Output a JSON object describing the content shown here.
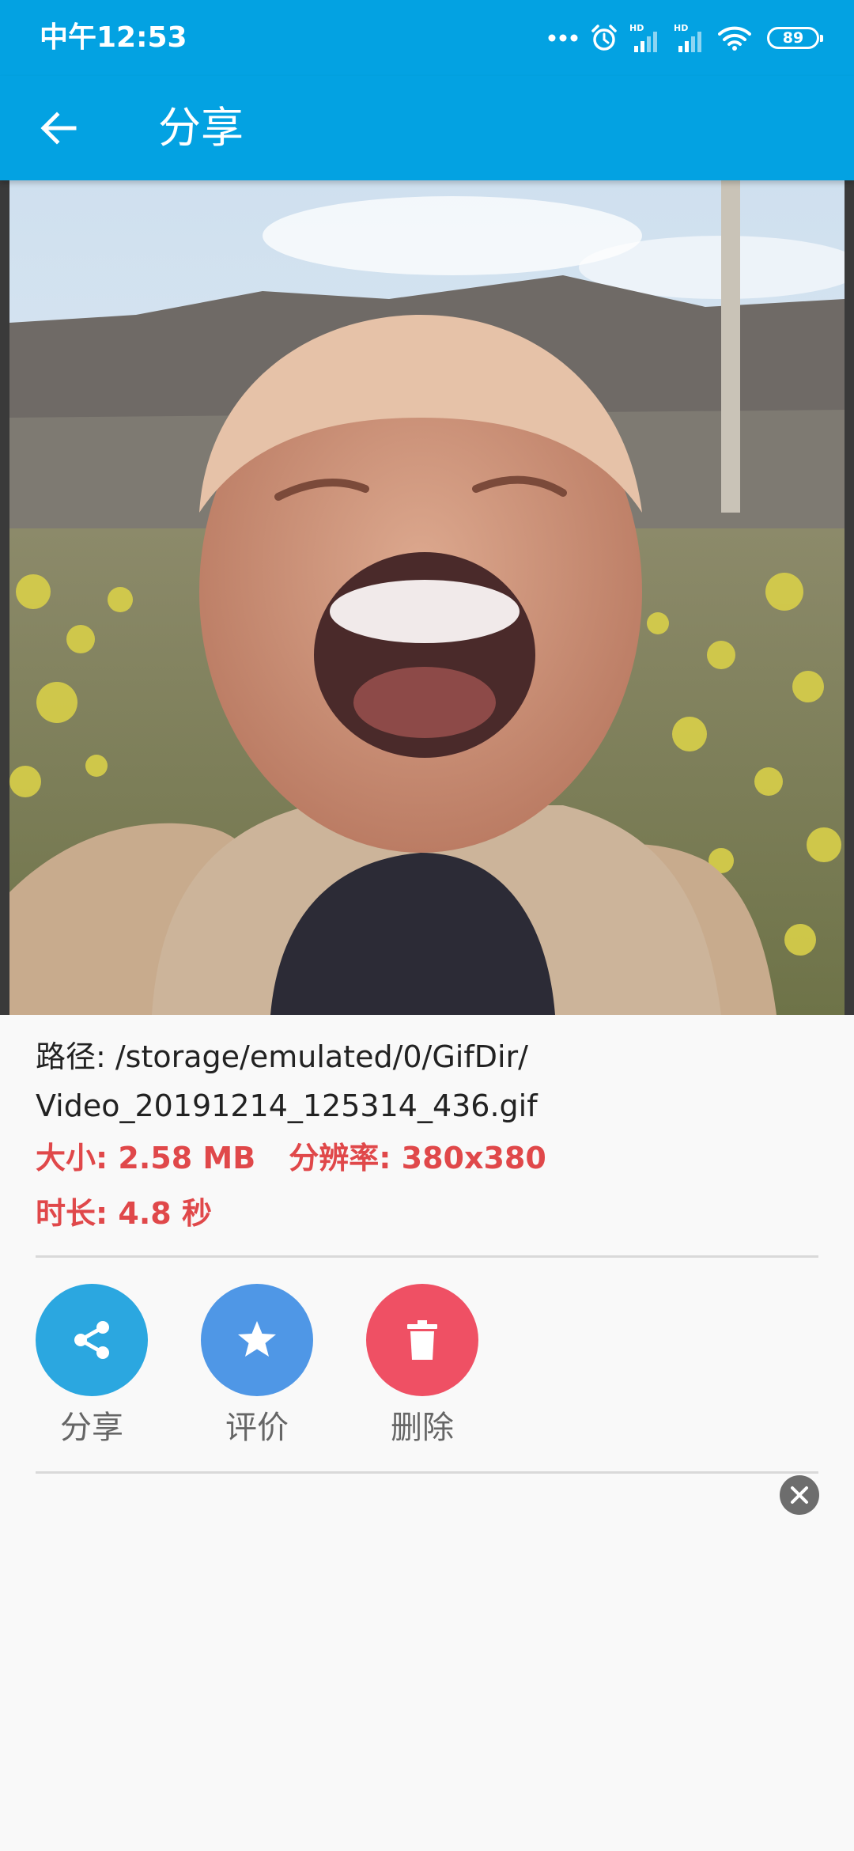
{
  "status_bar": {
    "time": "中午12:53",
    "battery": "89",
    "icons": [
      "more-dots-icon",
      "alarm-icon",
      "signal-hd-icon",
      "signal-hd-icon",
      "wifi-icon",
      "battery-icon"
    ],
    "hd_badge": "HD"
  },
  "app_bar": {
    "title": "分享",
    "back_icon": "arrow-left-icon"
  },
  "colors": {
    "primary": "#03a2e2",
    "meta_text": "#e0484a",
    "share": "#2ba7e0",
    "rate": "#4f97e6",
    "delete": "#ef5064"
  },
  "file_info": {
    "path_line1": "路径: /storage/emulated/0/GifDir/",
    "path_line2": "Video_20191214_125314_436.gif",
    "size": "大小: 2.58 MB",
    "resolution": "分辨率: 380x380",
    "duration": "时长: 4.8 秒"
  },
  "actions": [
    {
      "label": "分享",
      "icon": "share-icon"
    },
    {
      "label": "评价",
      "icon": "star-icon"
    },
    {
      "label": "删除",
      "icon": "trash-icon"
    }
  ],
  "ad_close_icon": "close-icon"
}
